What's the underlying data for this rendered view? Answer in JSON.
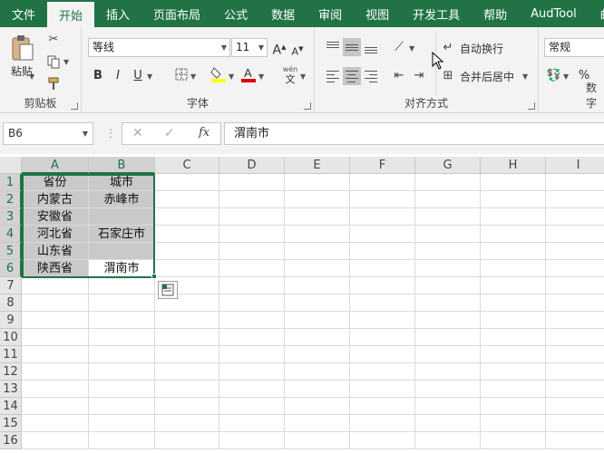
{
  "tabs": [
    "文件",
    "开始",
    "插入",
    "页面布局",
    "公式",
    "数据",
    "审阅",
    "视图",
    "开发工具",
    "帮助",
    "AudTool",
    "邮"
  ],
  "active_tab": "开始",
  "ribbon": {
    "clipboard": {
      "paste_label": "粘贴",
      "group_label": "剪贴板"
    },
    "font": {
      "font_name": "等线",
      "font_size": "11",
      "grow": "A",
      "shrink": "A",
      "bold": "B",
      "italic": "I",
      "underline": "U",
      "phonetic_top": "wén",
      "phonetic_bottom": "文",
      "group_label": "字体"
    },
    "alignment": {
      "wrap_text": "自动换行",
      "merge_center": "合并后居中",
      "group_label": "对齐方式"
    },
    "number": {
      "format": "常规",
      "percent": "%",
      "group_label": "数字"
    }
  },
  "formula_bar": {
    "name_box": "B6",
    "cancel": "✕",
    "enter": "✓",
    "fx": "fx",
    "formula": "渭南市"
  },
  "columns": [
    "A",
    "B",
    "C",
    "D",
    "E",
    "F",
    "G",
    "H",
    "I"
  ],
  "rows": [
    "1",
    "2",
    "3",
    "4",
    "5",
    "6",
    "7",
    "8",
    "9",
    "10",
    "11",
    "12",
    "13",
    "14",
    "15",
    "16"
  ],
  "cells": {
    "A1": "省份",
    "B1": "城市",
    "A2": "内蒙古",
    "B2": "赤峰市",
    "A3": "安徽省",
    "B3": "",
    "A4": "河北省",
    "B4": "石家庄市",
    "A5": "山东省",
    "B5": "",
    "A6": "陕西省",
    "B6": "渭南市"
  },
  "colors": {
    "accent": "#217346",
    "selection_shade": "#c9c9c9"
  },
  "icons": [
    "paste-icon",
    "cut-icon",
    "copy-icon",
    "format-painter-icon",
    "border-icon",
    "fill-color-icon",
    "font-color-icon",
    "orientation-icon",
    "wrap-text-icon",
    "merge-center-icon",
    "currency-icon",
    "quick-analysis-icon"
  ]
}
